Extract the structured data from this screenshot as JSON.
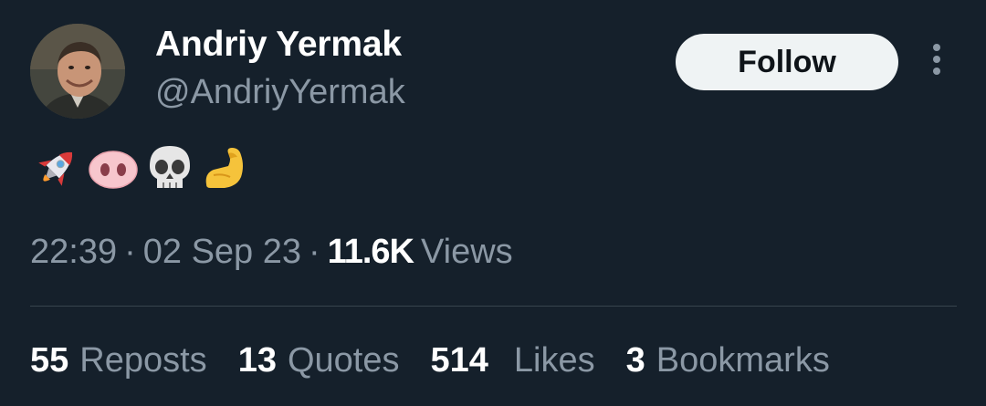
{
  "author": {
    "name": "Andriy Yermak",
    "handle": "@AndriyYermak"
  },
  "follow_label": "Follow",
  "more_icon": "more-vertical-icon",
  "tweet": {
    "emojis": [
      "rocket",
      "pig-nose",
      "skull",
      "flexed-biceps"
    ]
  },
  "meta": {
    "time": "22:39",
    "separator": "·",
    "date": "02 Sep 23",
    "views_count": "11.6K",
    "views_label": "Views"
  },
  "stats": {
    "reposts": {
      "count": "55",
      "label": "Reposts"
    },
    "quotes": {
      "count": "13",
      "label": "Quotes"
    },
    "likes": {
      "count": "514",
      "label": "Likes"
    },
    "bookmarks": {
      "count": "3",
      "label": "Bookmarks"
    }
  },
  "colors": {
    "background": "#15202b",
    "text_primary": "#ffffff",
    "text_secondary": "#8b98a5",
    "divider": "#38444d",
    "button_bg": "#eff3f4"
  }
}
